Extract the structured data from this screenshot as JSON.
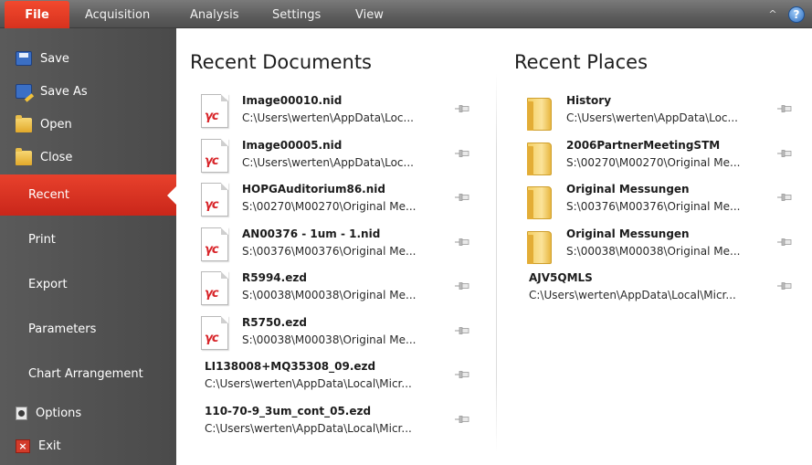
{
  "ribbon": {
    "tabs": [
      "File",
      "Acquisition",
      "Analysis",
      "Settings",
      "View"
    ],
    "collapse_glyph": "^",
    "help_glyph": "?"
  },
  "nav": {
    "save": "Save",
    "save_as": "Save As",
    "open": "Open",
    "close": "Close",
    "recent": "Recent",
    "print": "Print",
    "export": "Export",
    "parameters": "Parameters",
    "chart_arrangement": "Chart Arrangement",
    "options": "Options",
    "exit": "Exit"
  },
  "recent_documents": {
    "title": "Recent Documents",
    "items": [
      {
        "name": "Image00010.nid",
        "path": "C:\\Users\\werten\\AppData\\Loc...",
        "icon": "nid-file-icon"
      },
      {
        "name": "Image00005.nid",
        "path": "C:\\Users\\werten\\AppData\\Loc...",
        "icon": "nid-file-icon"
      },
      {
        "name": "HOPGAuditorium86.nid",
        "path": "S:\\00270\\M00270\\Original Me...",
        "icon": "nid-file-icon"
      },
      {
        "name": "AN00376 - 1um - 1.nid",
        "path": "S:\\00376\\M00376\\Original Me...",
        "icon": "nid-file-icon"
      },
      {
        "name": "R5994.ezd",
        "path": "S:\\00038\\M00038\\Original Me...",
        "icon": "nid-file-icon"
      },
      {
        "name": "R5750.ezd",
        "path": "S:\\00038\\M00038\\Original Me...",
        "icon": "nid-file-icon"
      },
      {
        "name": "LI138008+MQ35308_09.ezd",
        "path": "C:\\Users\\werten\\AppData\\Local\\Micr...",
        "icon": "none"
      },
      {
        "name": "110-70-9_3um_cont_05.ezd",
        "path": "C:\\Users\\werten\\AppData\\Local\\Micr...",
        "icon": "none"
      }
    ]
  },
  "recent_places": {
    "title": "Recent Places",
    "items": [
      {
        "name": "History",
        "path": "C:\\Users\\werten\\AppData\\Loc...",
        "icon": "folder-icon"
      },
      {
        "name": "2006PartnerMeetingSTM",
        "path": "S:\\00270\\M00270\\Original Me...",
        "icon": "folder-icon"
      },
      {
        "name": "Original Messungen",
        "path": "S:\\00376\\M00376\\Original Me...",
        "icon": "folder-icon"
      },
      {
        "name": "Original Messungen",
        "path": "S:\\00038\\M00038\\Original Me...",
        "icon": "folder-icon"
      },
      {
        "name": "AJV5QMLS",
        "path": "C:\\Users\\werten\\AppData\\Local\\Micr...",
        "icon": "none"
      }
    ]
  },
  "colors": {
    "accent": "#d7321e",
    "nav_bg": "#4f4f4f",
    "tabbar_bg": "#606060"
  }
}
